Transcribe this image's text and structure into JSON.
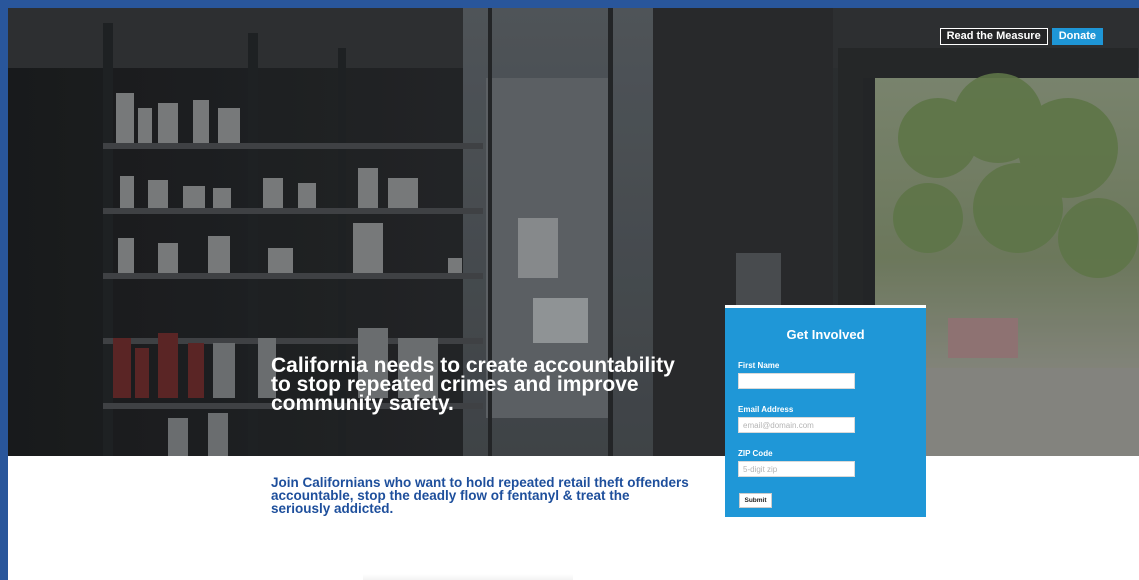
{
  "nav": {
    "read_measure_label": "Read the Measure",
    "donate_label": "Donate"
  },
  "hero": {
    "headline": "California needs to create accountability to stop repeated crimes and improve community safety."
  },
  "intro": {
    "text": "Join Californians who want to hold repeated retail theft offenders accountable, stop the deadly flow of fentanyl & treat the seriously addicted."
  },
  "form": {
    "title": "Get Involved",
    "first_name_label": "First Name",
    "first_name_value": "",
    "email_label": "Email Address",
    "email_placeholder": "email@domain.com",
    "zip_label": "ZIP Code",
    "zip_placeholder": "5-digit zip",
    "submit_label": "Submit"
  },
  "colors": {
    "brand_blue": "#1f97d7",
    "text_blue": "#1e4f9c",
    "border_blue": "#29569b"
  }
}
